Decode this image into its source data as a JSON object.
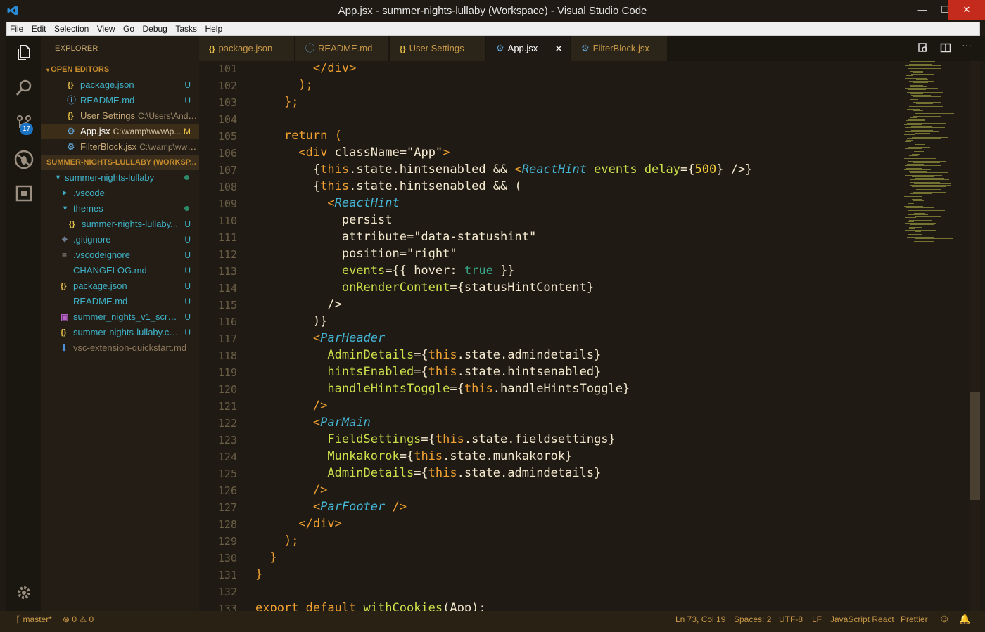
{
  "window": {
    "title": "App.jsx - summer-nights-lullaby (Workspace) - Visual Studio Code",
    "minimize": "—",
    "maximize": "☐",
    "close": "✕"
  },
  "menu": [
    "File",
    "Edit",
    "Selection",
    "View",
    "Go",
    "Debug",
    "Tasks",
    "Help"
  ],
  "activity": {
    "scm_badge": "17"
  },
  "sidebar": {
    "title": "EXPLORER",
    "open_editors_label": "OPEN EDITORS",
    "open_editors": [
      {
        "icon": "{}",
        "name": "package.json",
        "path": "",
        "status": "U"
      },
      {
        "icon": "ⓘ",
        "name": "README.md",
        "path": "",
        "status": "U"
      },
      {
        "icon": "{}",
        "name": "User Settings",
        "path": "C:\\Users\\Andrá...",
        "status": ""
      },
      {
        "icon": "⚙",
        "name": "App.jsx",
        "path": "C:\\wamp\\www\\p...",
        "status": "M"
      },
      {
        "icon": "⚙",
        "name": "FilterBlock.jsx",
        "path": "C:\\wamp\\www...",
        "status": ""
      }
    ],
    "workspace_label": "SUMMER-NIGHTS-LULLABY (WORKSP...",
    "tree": [
      {
        "icon": "▾",
        "name": "summer-nights-lullaby",
        "status": "dot"
      },
      {
        "icon": "▸",
        "name": ".vscode",
        "status": ""
      },
      {
        "icon": "▾",
        "name": "themes",
        "status": "dot"
      },
      {
        "icon": "{}",
        "name": "summer-nights-lullaby...",
        "status": "U"
      },
      {
        "icon": "◆",
        "name": ".gitignore",
        "status": "U"
      },
      {
        "icon": "≡",
        "name": ".vscodeignore",
        "status": "U"
      },
      {
        "icon": "",
        "name": "CHANGELOG.md",
        "status": "U"
      },
      {
        "icon": "{}",
        "name": "package.json",
        "status": "U"
      },
      {
        "icon": "",
        "name": "README.md",
        "status": "U"
      },
      {
        "icon": "▣",
        "name": "summer_nights_v1_scree...",
        "status": "U"
      },
      {
        "icon": "{}",
        "name": "summer-nights-lullaby.co...",
        "status": "U"
      },
      {
        "icon": "⬇",
        "name": "vsc-extension-quickstart.md",
        "status": ""
      }
    ]
  },
  "tabs": [
    {
      "icon": "{}",
      "label": "package.json"
    },
    {
      "icon": "ⓘ",
      "label": "README.md"
    },
    {
      "icon": "{}",
      "label": "User Settings"
    },
    {
      "icon": "⚙",
      "label": "App.jsx",
      "close": "✕"
    },
    {
      "icon": "⚙",
      "label": "FilterBlock.jsx"
    }
  ],
  "editor": {
    "line_numbers": [
      "101",
      "102",
      "103",
      "104",
      "105",
      "106",
      "107",
      "108",
      "109",
      "110",
      "111",
      "112",
      "113",
      "114",
      "115",
      "116",
      "117",
      "118",
      "119",
      "120",
      "121",
      "122",
      "123",
      "124",
      "125",
      "126",
      "127",
      "128",
      "129",
      "130",
      "131",
      "132",
      "133"
    ]
  },
  "status": {
    "branch": "master*",
    "errors": "0",
    "warnings": "0",
    "position": "Ln 73, Col 19",
    "spaces": "Spaces: 2",
    "encoding": "UTF-8",
    "eol": "LF",
    "language": "JavaScript React",
    "formatter": "Prettier",
    "smiley": "☺",
    "bell": "🔔"
  },
  "colors": {
    "accent": "#f0a030",
    "teal": "#3fb3c9",
    "statusbar": "#2a2115",
    "close": "#c42b1c"
  }
}
